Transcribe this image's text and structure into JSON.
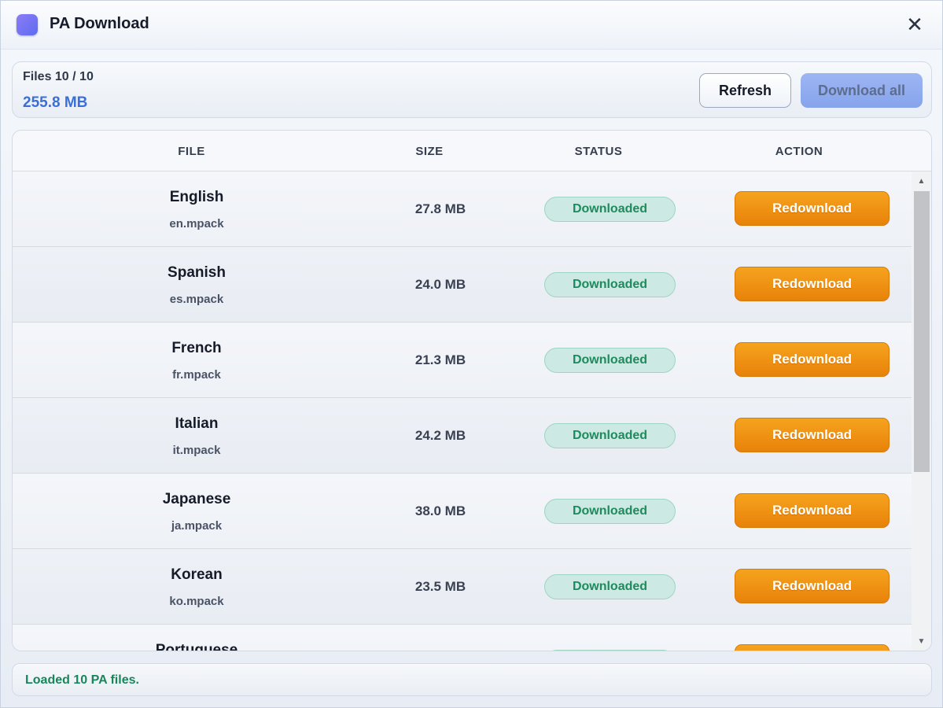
{
  "window": {
    "title": "PA Download",
    "close_glyph": "✕"
  },
  "summary": {
    "files_label": "Files 10 / 10",
    "total_size": "255.8 MB",
    "refresh_label": "Refresh",
    "download_all_label": "Download all",
    "download_all_disabled": true
  },
  "table": {
    "headers": {
      "file": "FILE",
      "size": "SIZE",
      "status": "STATUS",
      "action": "ACTION"
    },
    "rows": [
      {
        "language": "English",
        "file": "en.mpack",
        "size": "27.8 MB",
        "status": "Downloaded",
        "action": "Redownload"
      },
      {
        "language": "Spanish",
        "file": "es.mpack",
        "size": "24.0 MB",
        "status": "Downloaded",
        "action": "Redownload"
      },
      {
        "language": "French",
        "file": "fr.mpack",
        "size": "21.3 MB",
        "status": "Downloaded",
        "action": "Redownload"
      },
      {
        "language": "Italian",
        "file": "it.mpack",
        "size": "24.2 MB",
        "status": "Downloaded",
        "action": "Redownload"
      },
      {
        "language": "Japanese",
        "file": "ja.mpack",
        "size": "38.0 MB",
        "status": "Downloaded",
        "action": "Redownload"
      },
      {
        "language": "Korean",
        "file": "ko.mpack",
        "size": "23.5 MB",
        "status": "Downloaded",
        "action": "Redownload"
      },
      {
        "language": "Portuguese",
        "file": "",
        "size": "",
        "status": "",
        "action": ""
      }
    ]
  },
  "scrollbar": {
    "up_glyph": "▲",
    "down_glyph": "▼"
  },
  "status_bar": {
    "message": "Loaded 10 PA files."
  },
  "colors": {
    "accent_blue": "#3a6fd8",
    "success_green": "#1f8a5c",
    "action_orange": "#f29514"
  }
}
